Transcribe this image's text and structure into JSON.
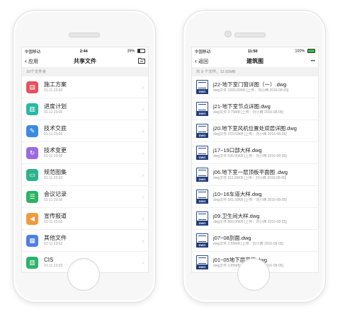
{
  "left": {
    "status": {
      "carrier": "中国移动",
      "time": "2:44",
      "battery": "39%",
      "battery_level": 0.39
    },
    "nav": {
      "back": "应用",
      "title": "共享文件",
      "right_icon": "folder-icon"
    },
    "subheader": "10个文件夹",
    "items": [
      {
        "name": "施工方案",
        "date": "01-11 23:02",
        "color": "#e8505b",
        "icon": "document-icon",
        "glyph": "▤"
      },
      {
        "name": "进度计划",
        "date": "01-11 23:02",
        "color": "#28b9a6",
        "icon": "bar-chart-icon",
        "glyph": "▥"
      },
      {
        "name": "技术交底",
        "date": "01-11 23:02",
        "color": "#3b8be0",
        "icon": "wrench-icon",
        "glyph": "✎"
      },
      {
        "name": "技术变更",
        "date": "01-11 23:02",
        "color": "#9b6ae0",
        "icon": "refresh-icon",
        "glyph": "↻"
      },
      {
        "name": "规范图集",
        "date": "01-11 23:02",
        "color": "#2cb38b",
        "icon": "folder-icon",
        "glyph": "▭"
      },
      {
        "name": "会议记录",
        "date": "01-11 23:02",
        "color": "#2bb364",
        "icon": "clipboard-icon",
        "glyph": "☰"
      },
      {
        "name": "宣传报道",
        "date": "01-11 23:02",
        "color": "#f29a3b",
        "icon": "megaphone-icon",
        "glyph": "◀"
      },
      {
        "name": "其他文件",
        "date": "01-11 23:02",
        "color": "#4d7ee8",
        "icon": "files-icon",
        "glyph": "▦"
      },
      {
        "name": "CIS",
        "date": "01-11 23:02",
        "color": "#2bb36b",
        "icon": "book-icon",
        "glyph": "▥"
      }
    ]
  },
  "right": {
    "status": {
      "carrier": "中国移动",
      "time": "11:50",
      "battery": "100%",
      "battery_level": 1.0
    },
    "nav": {
      "back": "返回",
      "title": "建筑图",
      "more": "•••"
    },
    "subheader": "共 9 个文件，12.93MB",
    "file_badge": "DWG",
    "items": [
      {
        "name": "j22-地下室门窗详图（一）.dwg",
        "meta": "dwg文件  1020.60KB  [上传：刘小西 2016-08-05]"
      },
      {
        "name": "j21-地下室节点详图.dwg",
        "meta": "dwg文件  2.75MB  [上传：刘小西 2016-08-05]"
      },
      {
        "name": "j20.地下室风机位置处双层详图.dwg",
        "meta": "dwg文件  223.69KB  [上传：刘小西 2016-08-05]"
      },
      {
        "name": "j17~19口部大样.dwg",
        "meta": "dwg文件  506.00KB  [上传：刘小西 2016-08-05]"
      },
      {
        "name": "j06.地下室一层顶板平面图 .dwg",
        "meta": "dwg文件  311.36KB  [上传：刘小西 2016-08-05]"
      },
      {
        "name": "j10~16车道大样.dwg",
        "meta": "dwg文件  581.50KB  [上传：刘小西 2016-08-05]"
      },
      {
        "name": "j09.卫生间大样.dwg",
        "meta": "dwg文件  900.00KB  [上传：刘小西 2016-08-05]"
      },
      {
        "name": "j07~08剖面.dwg",
        "meta": "dwg文件  3.55MB  [上传：刘小西 2016-08-05]"
      },
      {
        "name": "j01~05地下层平面.dwg",
        "meta": "dwg文件  3.85MB  [上传：刘小西 2016-08-05]"
      }
    ]
  }
}
